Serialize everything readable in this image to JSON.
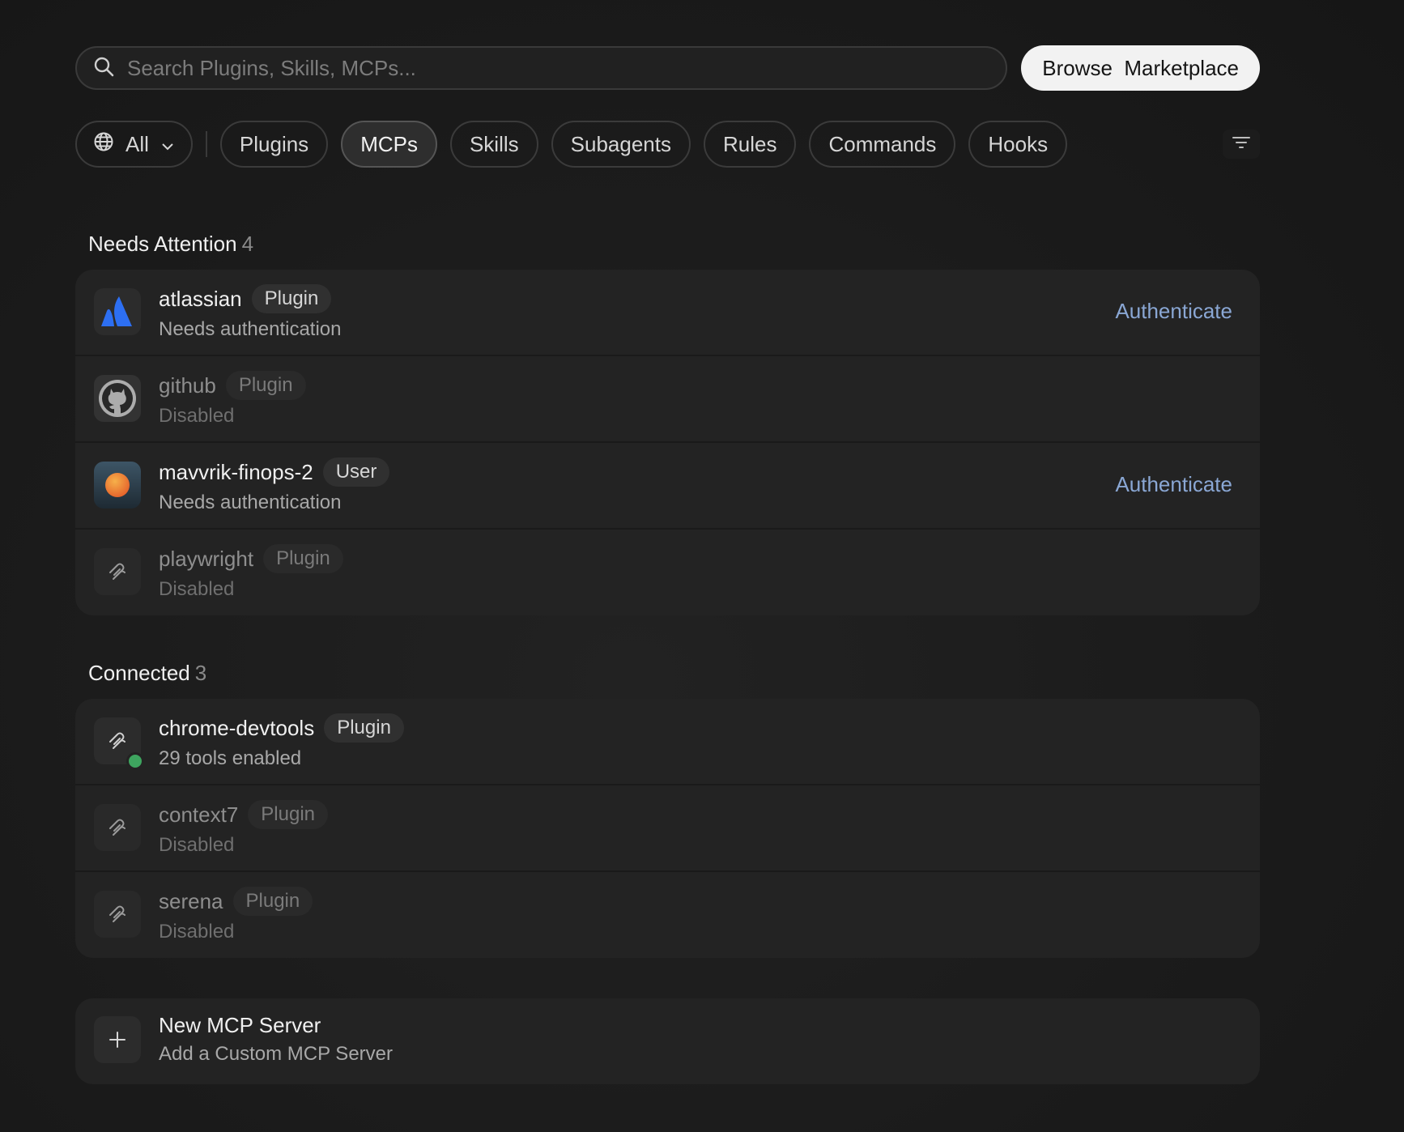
{
  "search": {
    "placeholder": "Search Plugins, Skills, MCPs..."
  },
  "browse_button": "Browse  Marketplace",
  "filters": {
    "all_label": "All",
    "chips": [
      "Plugins",
      "MCPs",
      "Skills",
      "Subagents",
      "Rules",
      "Commands",
      "Hooks"
    ],
    "active": "MCPs"
  },
  "needs_attention": {
    "title": "Needs Attention",
    "count": "4",
    "items": [
      {
        "name": "atlassian",
        "badge": "Plugin",
        "status": "Needs authentication",
        "action": "Authenticate",
        "icon": "atlassian-logo-icon"
      },
      {
        "name": "github",
        "badge": "Plugin",
        "status": "Disabled",
        "action": "",
        "icon": "github-logo-icon"
      },
      {
        "name": "mavvrik-finops-2",
        "badge": "User",
        "status": "Needs authentication",
        "action": "Authenticate",
        "icon": "mavvrik-logo-icon"
      },
      {
        "name": "playwright",
        "badge": "Plugin",
        "status": "Disabled",
        "action": "",
        "icon": "mcp-plug-icon"
      }
    ]
  },
  "connected": {
    "title": "Connected",
    "count": "3",
    "items": [
      {
        "name": "chrome-devtools",
        "badge": "Plugin",
        "status": "29 tools enabled",
        "icon": "mcp-plug-icon",
        "online": true
      },
      {
        "name": "context7",
        "badge": "Plugin",
        "status": "Disabled",
        "icon": "mcp-plug-icon"
      },
      {
        "name": "serena",
        "badge": "Plugin",
        "status": "Disabled",
        "icon": "mcp-plug-icon"
      }
    ]
  },
  "new_server": {
    "title": "New MCP Server",
    "subtitle": "Add a Custom MCP Server"
  },
  "colors": {
    "accent_link": "#8aa7d4",
    "online_dot": "#3ea55f",
    "atlassian_blue": "#2d6ff2"
  }
}
